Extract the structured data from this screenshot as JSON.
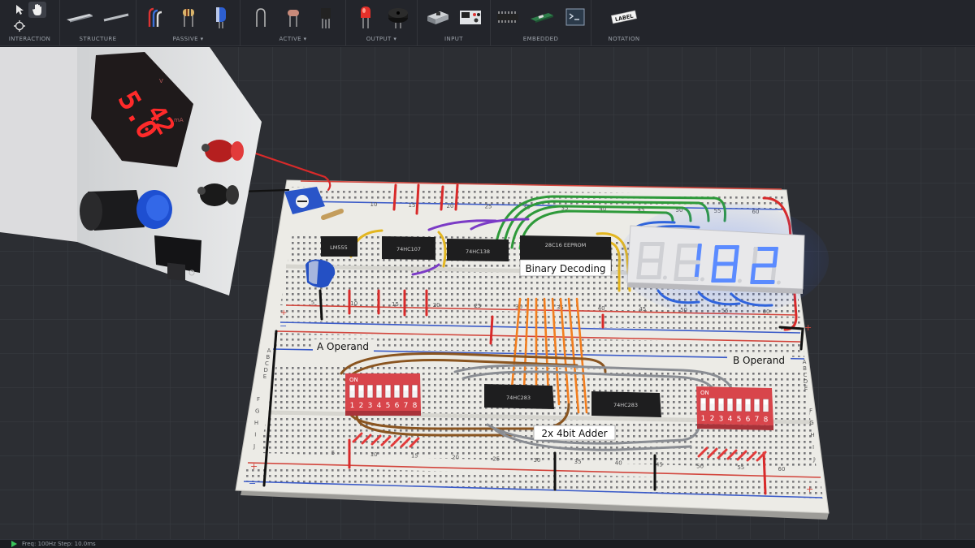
{
  "toolbar": {
    "groups": [
      {
        "label": "INTERACTION"
      },
      {
        "label": "STRUCTURE"
      },
      {
        "label": "PASSIVE ▾"
      },
      {
        "label": "ACTIVE ▾"
      },
      {
        "label": "OUTPUT ▾"
      },
      {
        "label": "INPUT"
      },
      {
        "label": "EMBEDDED"
      },
      {
        "label": "NOTATION"
      }
    ],
    "notation_icon_text": "LABEL"
  },
  "power_supply": {
    "voltage": "5.0",
    "current": "42",
    "voltage_unit": "V",
    "current_unit": "mA"
  },
  "seven_segment": {
    "digits": [
      "",
      "1",
      "8",
      "2"
    ]
  },
  "chips": {
    "lm555": "LM555",
    "c74hc107": "74HC107",
    "c74hc138": "74HC138",
    "eeprom": "28C16 EEPROM",
    "adder1": "74HC283",
    "adder2": "74HC283"
  },
  "labels": {
    "binary_decoding": "Binary Decoding",
    "a_operand": "A Operand",
    "b_operand": "B Operand",
    "adder": "2x 4bit Adder"
  },
  "dip_switch": {
    "on_label": "ON",
    "numbers": [
      "1",
      "2",
      "3",
      "4",
      "5",
      "6",
      "7",
      "8"
    ]
  },
  "breadboard": {
    "top_col_numbers": [
      "10",
      "15",
      "20",
      "25",
      "30",
      "35",
      "40",
      "45",
      "50",
      "55",
      "60"
    ],
    "mid_col_numbers": [
      "5",
      "10",
      "15",
      "20",
      "25",
      "30",
      "35",
      "40",
      "45",
      "50",
      "55",
      "60"
    ],
    "bot_col_numbers": [
      "5",
      "10",
      "15",
      "20",
      "25",
      "30",
      "35",
      "40",
      "45",
      "50",
      "55",
      "60"
    ],
    "row_letters_left": [
      "A",
      "B",
      "C",
      "D",
      "E"
    ],
    "row_letters_left2": [
      "F",
      "G",
      "H",
      "I",
      "J"
    ],
    "row_letters_right": [
      "A",
      "B",
      "C",
      "D",
      "E"
    ],
    "row_letters_right2": [
      "F",
      "G",
      "H",
      "I",
      "J"
    ],
    "rail_plus": "+",
    "rail_minus": "−"
  },
  "status": {
    "text": "Freq: 100Hz  Step: 10.0ms"
  },
  "colors": {
    "toolbar_bg": "#23252b",
    "viewport_bg": "#2a2c31",
    "breadboard": "#ecebe6",
    "rail_red": "#d2453c",
    "rail_blue": "#3b5bc8",
    "seg_on": "#5b8bff",
    "psu_digits": "#ff2a2a",
    "dip_red": "#d8454b"
  }
}
